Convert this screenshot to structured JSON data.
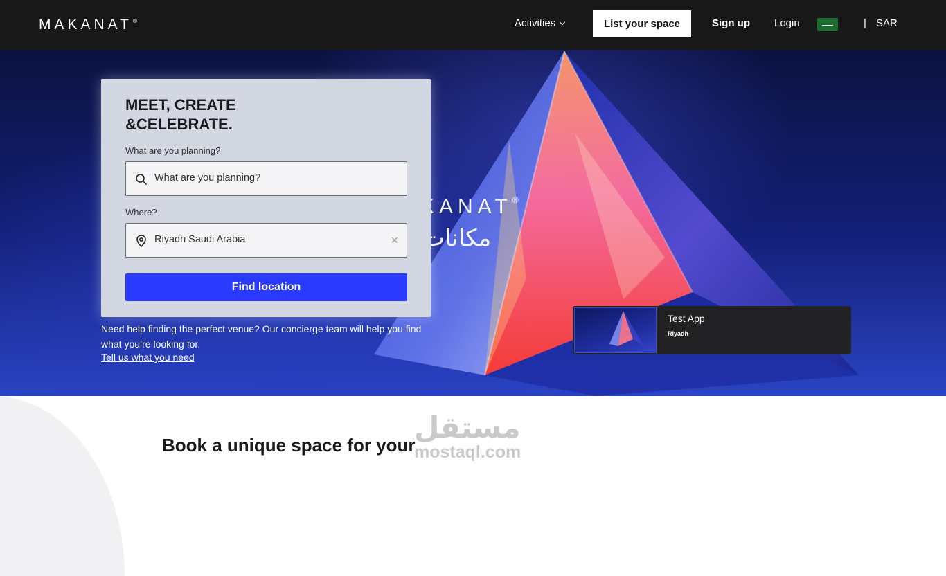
{
  "header": {
    "logo": "MAKANAT",
    "logo_mark": "®",
    "nav": {
      "activities": "Activities",
      "list_space": "List your space",
      "sign_up": "Sign up",
      "login": "Login",
      "separator": "|",
      "currency": "SAR"
    },
    "flag_icon": "saudi-flag-icon"
  },
  "hero": {
    "logo_en": "MAKANAT",
    "logo_mark": "®",
    "logo_ar": "مكانات",
    "search_card": {
      "title": "MEET, CREATE &CELEBRATE.",
      "planning_label": "What are you planning?",
      "planning_placeholder": "What are you planning?",
      "where_label": "Where?",
      "where_value": "Riyadh Saudi Arabia",
      "clear_symbol": "×",
      "find_button": "Find location"
    },
    "help_text": "Need help finding the perfect venue? Our concierge team will help you find what you’re looking for.",
    "help_link": "Tell us what you need",
    "listing": {
      "name": "Test App",
      "city": "Riyadh"
    }
  },
  "section": {
    "title": "Book a unique space for your"
  },
  "watermark": {
    "arabic": "مستقل",
    "latin": "mostaql.com"
  },
  "colors": {
    "header_bg": "#181818",
    "primary_button": "#2b3aff",
    "card_bg": "#d3d7e1",
    "listing_bg": "#222224"
  }
}
